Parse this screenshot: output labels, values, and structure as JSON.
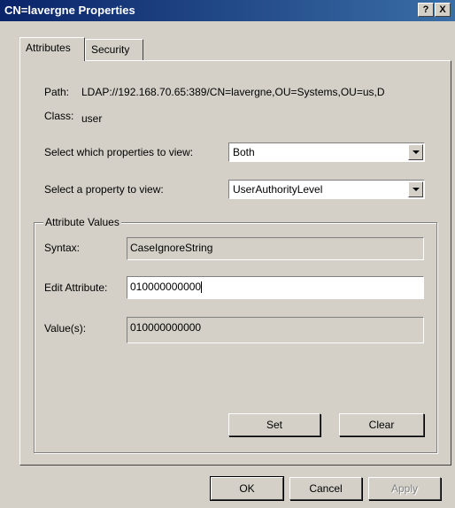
{
  "window": {
    "title": "CN=lavergne Properties",
    "help_button": "?",
    "close_button": "X"
  },
  "tabs": [
    {
      "label": "Attributes",
      "active": true
    },
    {
      "label": "Security",
      "active": false
    }
  ],
  "path": {
    "label": "Path:",
    "value": "LDAP://192.168.70.65:389/CN=lavergne,OU=Systems,OU=us,D"
  },
  "class": {
    "label": "Class:",
    "value": "user"
  },
  "select_properties": {
    "label": "Select which properties to view:",
    "value": "Both"
  },
  "select_property": {
    "label": "Select a property to view:",
    "value": "UserAuthorityLevel"
  },
  "attribute_values": {
    "legend": "Attribute Values",
    "syntax": {
      "label": "Syntax:",
      "value": "CaseIgnoreString"
    },
    "edit": {
      "label": "Edit Attribute:",
      "value": "010000000000"
    },
    "values": {
      "label": "Value(s):",
      "value": "010000000000"
    },
    "set_button": "Set",
    "clear_button": "Clear"
  },
  "footer": {
    "ok": "OK",
    "cancel": "Cancel",
    "apply": "Apply"
  }
}
